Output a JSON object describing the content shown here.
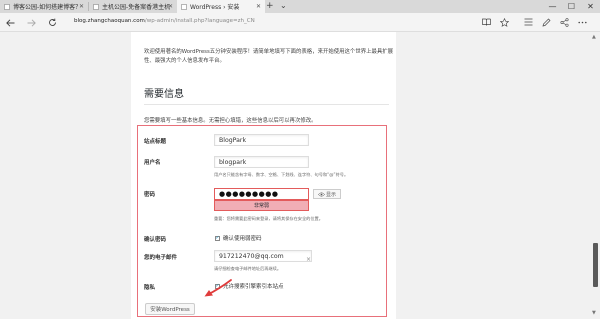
{
  "browser": {
    "tabs": [
      {
        "title": "博客公园-如何搭建博客？",
        "active": false
      },
      {
        "title": "主机公园-免备案香港主机",
        "active": false
      },
      {
        "title": "WordPress › 安装",
        "active": true
      }
    ],
    "new_tab": "+",
    "tab_menu": "⌄",
    "window": {
      "minimize": "—",
      "maximize": "☐",
      "close": "✕"
    },
    "url_host": "blog.zhangchaoquan.com",
    "url_path": "/wp-admin/install.php?language=zh_CN"
  },
  "page": {
    "intro": "欢迎使用著名的WordPress五分钟安装程序！请简单地填写下面的表格，来开始使用这个世界上最具扩展性、最强大的个人信息发布平台。",
    "heading": "需要信息",
    "subtext": "您需要填写一些基本信息。无需担心填错，这些信息以后可以再次修改。",
    "form": {
      "site_title_label": "站点标题",
      "site_title_value": "BlogPark",
      "username_label": "用户名",
      "username_value": "blogpark",
      "username_hint": "用户名只能含有字母、数字、空格、下划线、连字符、句号和“@”符号。",
      "password_label": "密码",
      "password_value": "●●●●●●●●●",
      "show_label": "显示",
      "strength_label": "非常弱",
      "password_hint": "重要：您将需要此密码来登录，请将其保存在安全的位置。",
      "confirm_label": "确认密码",
      "confirm_checkbox": "确认使用弱密码",
      "email_label": "您的电子邮件",
      "email_value": "917212470@qq.com",
      "email_clear": "×",
      "email_hint": "请仔细检查电子邮件地址后再继续。",
      "privacy_label": "隐私",
      "privacy_checkbox": "允许搜索引擎索引本站点",
      "install_button": "安装WordPress"
    }
  },
  "colors": {
    "highlight_border": "#e8707a",
    "strength_bg": "#f1aeb5",
    "annotation_arrow": "#e03c3c"
  }
}
